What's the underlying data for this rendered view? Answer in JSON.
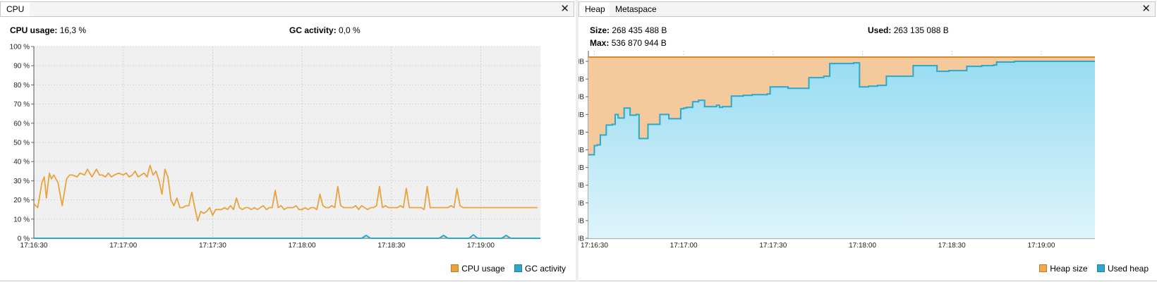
{
  "colors": {
    "orange": "#e8a33d",
    "blue": "#2ba8cc",
    "heap_fill": "#f4c99c",
    "used_fill": "#aee4f5",
    "plot_bg": "#f0f0f0"
  },
  "cpu_panel": {
    "tab_label": "CPU",
    "close_icon": "close-icon",
    "stats": {
      "cpu_label": "CPU usage:",
      "cpu_value": "16,3 %",
      "gc_label": "GC activity:",
      "gc_value": "0,0 %"
    },
    "legend": {
      "cpu": "CPU usage",
      "gc": "GC activity"
    },
    "chart_data": {
      "type": "line",
      "title": "",
      "y_ticks": [
        "0 %",
        "10 %",
        "20 %",
        "30 %",
        "40 %",
        "50 %",
        "60 %",
        "70 %",
        "80 %",
        "90 %",
        "100 %"
      ],
      "x_ticks": [
        "17:16:30",
        "17:17:00",
        "17:17:30",
        "17:18:00",
        "17:18:30",
        "17:19:00"
      ],
      "ylim": [
        0,
        100
      ],
      "x_range_seconds": [
        0,
        170
      ],
      "x_tick_seconds": [
        0,
        30,
        60,
        90,
        120,
        150
      ],
      "grid": true,
      "legend_position": "bottom-right",
      "series": [
        {
          "name": "CPU usage",
          "x": [
            0,
            1.3,
            2.7,
            3.5,
            4.2,
            5.2,
            5.9,
            6.7,
            8.1,
            9.5,
            11,
            12,
            13,
            14.5,
            15.5,
            17,
            18,
            19.5,
            21,
            22,
            23,
            24,
            25,
            26,
            27,
            28.5,
            30,
            31,
            32,
            33,
            34,
            35,
            36,
            37,
            38,
            39,
            40,
            41,
            42,
            43,
            44,
            45,
            46,
            47,
            48,
            49,
            50,
            51,
            52,
            53,
            54,
            55,
            56,
            57,
            58,
            59,
            60,
            61,
            62,
            63,
            64,
            65,
            66,
            67,
            68,
            69,
            70,
            71,
            72,
            73,
            74,
            75,
            76,
            77,
            78,
            79,
            80,
            81,
            82,
            83,
            84,
            85,
            86,
            87,
            88,
            89,
            90,
            91,
            92,
            93,
            94,
            95,
            96,
            97,
            98,
            99,
            100,
            101,
            102,
            103,
            104,
            105,
            106,
            107,
            108,
            109,
            110,
            111,
            112,
            113,
            114,
            115,
            116,
            117,
            118,
            119,
            120,
            121,
            122,
            123,
            124,
            125,
            126,
            127,
            128,
            129,
            130,
            131,
            132,
            133,
            134,
            135,
            136,
            137,
            138,
            139,
            140,
            141,
            142,
            143,
            144,
            145,
            146,
            147,
            148,
            149,
            150,
            151,
            152,
            153,
            154,
            155,
            156,
            157,
            158,
            159,
            160,
            161,
            162,
            163,
            164,
            165,
            166,
            167,
            168,
            169,
            170
          ],
          "y": [
            18,
            16,
            29,
            32,
            21,
            34,
            31,
            33,
            29,
            17,
            31,
            33,
            33,
            32,
            34,
            33,
            36,
            32,
            36,
            33,
            33,
            32,
            34,
            32,
            33,
            34,
            33,
            34,
            32,
            33,
            35,
            32,
            33,
            34,
            32,
            38,
            33,
            35,
            30,
            23,
            36,
            32,
            20,
            17,
            21,
            16,
            16,
            17,
            17,
            24,
            16,
            9,
            14,
            13,
            14,
            16,
            12,
            15,
            15,
            15,
            16,
            15,
            17,
            15,
            21,
            16,
            15,
            16,
            16,
            15,
            16,
            15,
            16,
            17,
            15,
            16,
            16,
            25,
            16,
            17,
            15,
            16,
            16,
            16,
            17,
            15,
            15,
            16,
            15,
            16,
            16,
            15,
            23,
            17,
            16,
            16,
            17,
            16,
            27,
            17,
            16,
            16,
            16,
            16,
            17,
            15,
            17,
            16,
            15,
            16,
            16,
            17,
            27,
            16,
            17,
            16,
            16,
            16,
            16,
            17,
            16,
            26,
            16,
            16,
            16,
            16,
            16,
            15,
            27,
            16,
            16,
            16,
            16,
            16,
            16,
            16,
            17,
            16,
            26,
            17,
            16,
            16,
            16,
            16,
            16,
            16,
            16,
            16,
            16,
            16,
            16,
            16,
            16,
            16,
            16,
            16,
            16,
            16,
            16,
            16,
            16,
            16,
            16,
            16,
            16,
            16
          ]
        },
        {
          "name": "GC activity",
          "x": [
            0,
            110,
            111.5,
            113,
            136,
            137.5,
            139,
            146,
            147.5,
            149,
            157,
            158.5,
            160,
            170
          ],
          "y": [
            0,
            0,
            1.5,
            0,
            0,
            1.5,
            0,
            0,
            1.8,
            0,
            0,
            1.5,
            0,
            0
          ]
        }
      ]
    }
  },
  "heap_panel": {
    "tabs": [
      {
        "label": "Heap",
        "active": true
      },
      {
        "label": "Metaspace",
        "active": false
      }
    ],
    "close_icon": "close-icon",
    "stats": {
      "size_label": "Size:",
      "size_value": "268 435 488 B",
      "used_label": "Used:",
      "used_value": "263 135 088 B",
      "max_label": "Max:",
      "max_value": "536 870 944 B"
    },
    "legend": {
      "heap": "Heap size",
      "used": "Used heap"
    },
    "chart_data": {
      "type": "area",
      "title": "",
      "y_ticks": [
        "0 MB",
        "25 MB",
        "50 MB",
        "75 MB",
        "100 MB",
        "125 MB",
        "150 MB",
        "175 MB",
        "200 MB",
        "225 MB",
        "250 MB"
      ],
      "x_ticks": [
        "17:16:30",
        "17:17:00",
        "17:17:30",
        "17:18:00",
        "17:18:30",
        "17:19:00"
      ],
      "ylim": [
        0,
        265
      ],
      "x_range_seconds": [
        -2,
        168
      ],
      "x_tick_seconds": [
        0,
        30,
        60,
        90,
        120,
        150
      ],
      "grid": true,
      "legend_position": "bottom-right",
      "series": [
        {
          "name": "Heap size",
          "x": [
            -2,
            168
          ],
          "y": [
            256,
            256
          ]
        },
        {
          "name": "Used heap",
          "x": [
            -2,
            -1,
            0,
            1,
            2,
            3,
            4,
            6,
            7,
            8,
            9,
            10,
            11,
            12,
            13,
            14,
            15,
            17,
            18,
            19,
            21,
            22,
            23,
            25,
            26,
            27,
            29,
            30,
            31,
            33,
            34,
            35,
            37,
            38,
            39,
            41,
            42,
            43,
            45,
            46,
            47,
            49,
            50,
            51,
            53,
            55,
            58,
            59,
            62,
            63,
            65,
            70,
            72,
            74,
            77,
            78,
            79,
            85,
            87,
            89,
            92,
            93,
            95,
            98,
            99,
            105,
            107,
            111,
            115,
            116,
            117,
            118,
            119,
            122,
            123,
            125,
            129,
            130,
            134,
            135,
            137,
            141,
            142,
            148,
            149,
            150,
            155,
            156,
            160,
            161,
            166,
            168
          ],
          "y": [
            118,
            118,
            131,
            132,
            146,
            146,
            160,
            161,
            175,
            170,
            170,
            184,
            184,
            174,
            174,
            175,
            141,
            141,
            161,
            161,
            161,
            175,
            175,
            169,
            169,
            169,
            183,
            184,
            185,
            193,
            193,
            195,
            186,
            186,
            186,
            188,
            185,
            186,
            186,
            201,
            201,
            201,
            202,
            202,
            203,
            203,
            204,
            214,
            214,
            214,
            212,
            212,
            227,
            227,
            229,
            229,
            247,
            247,
            248,
            214,
            215,
            215,
            216,
            229,
            229,
            229,
            244,
            244,
            236,
            236,
            236,
            236,
            237,
            237,
            237,
            243,
            243,
            244,
            245,
            249,
            249,
            250,
            250,
            250,
            250,
            250,
            250,
            250,
            250,
            250,
            250,
            250
          ]
        }
      ]
    }
  }
}
